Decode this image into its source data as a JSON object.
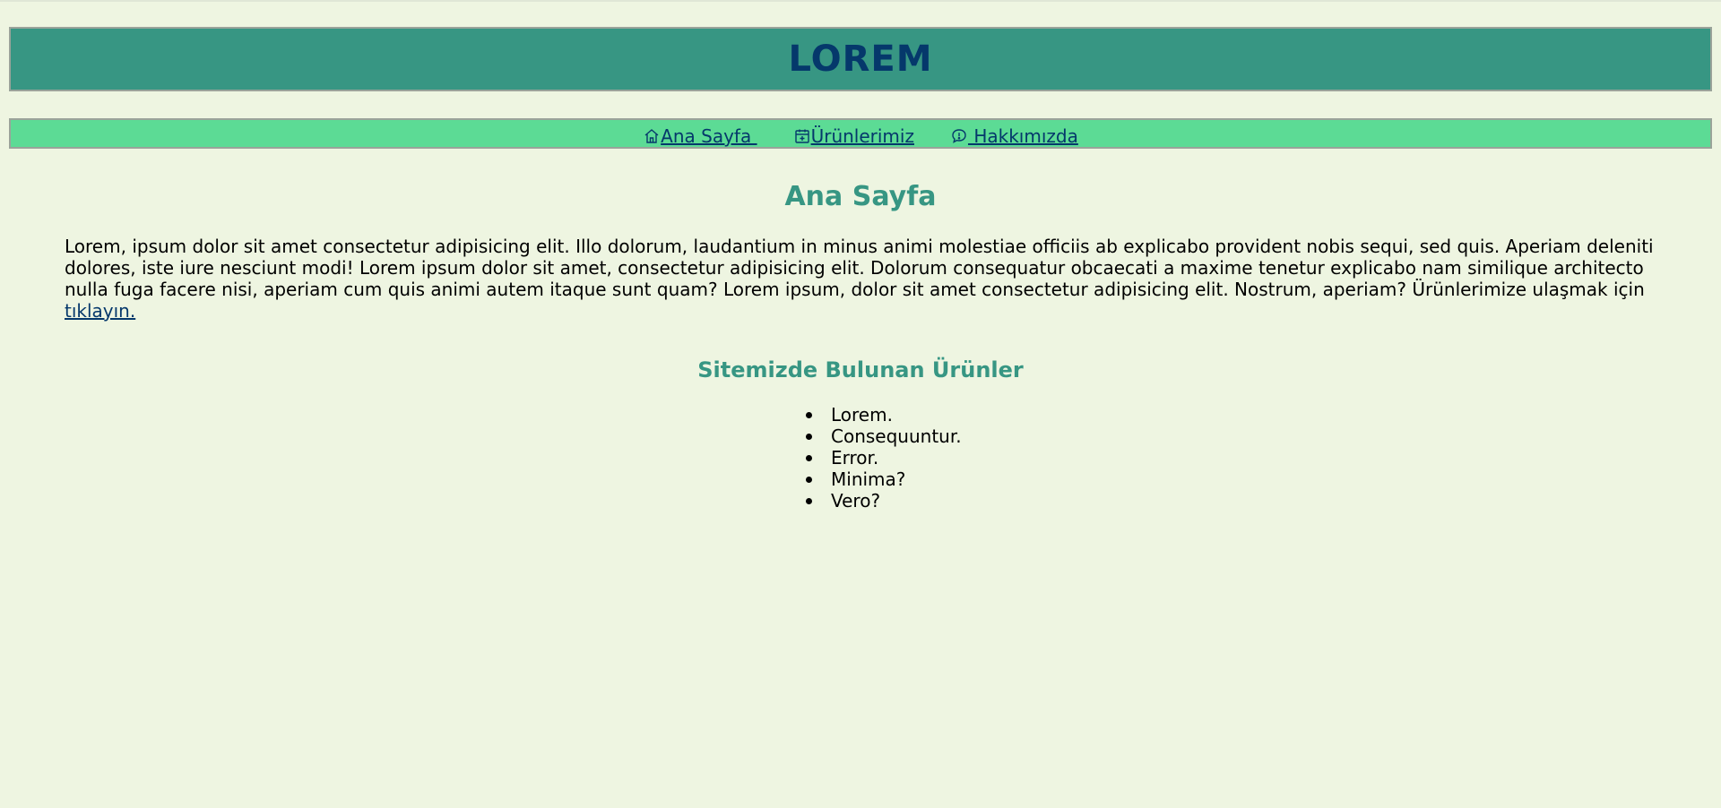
{
  "header": {
    "title": "LOREM"
  },
  "nav": {
    "items": [
      {
        "label": "Ana Sayfa ",
        "icon": "home-icon"
      },
      {
        "label": "Ürünlerimiz",
        "icon": "calendar-plus-icon"
      },
      {
        "label": " Hakkımızda",
        "icon": "chat-info-icon"
      }
    ]
  },
  "main": {
    "title": "Ana Sayfa",
    "intro_text": "Lorem, ipsum dolor sit amet consectetur adipisicing elit. Illo dolorum, laudantium in minus animi molestiae officiis ab explicabo provident nobis sequi, sed quis. Aperiam deleniti dolores, iste iure nesciunt modi! Lorem ipsum dolor sit amet, consectetur adipisicing elit. Dolorum consequatur obcaecati a maxime tenetur explicabo nam similique architecto nulla fuga facere nisi, aperiam cum quis animi autem itaque sunt quam? Lorem ipsum, dolor sit amet consectetur adipisicing elit. Nostrum, aperiam? Ürünlerimize ulaşmak için ",
    "intro_link": "tıklayın.",
    "products_title": "Sitemizde Bulunan Ürünler",
    "products": [
      "Lorem.",
      "Consequuntur.",
      "Error.",
      "Minima?",
      "Vero?"
    ]
  },
  "colors": {
    "background": "#eef5e1",
    "header_bg": "#379683",
    "nav_bg": "#5cdb95",
    "title_text": "#05386b",
    "heading_text": "#379683"
  }
}
